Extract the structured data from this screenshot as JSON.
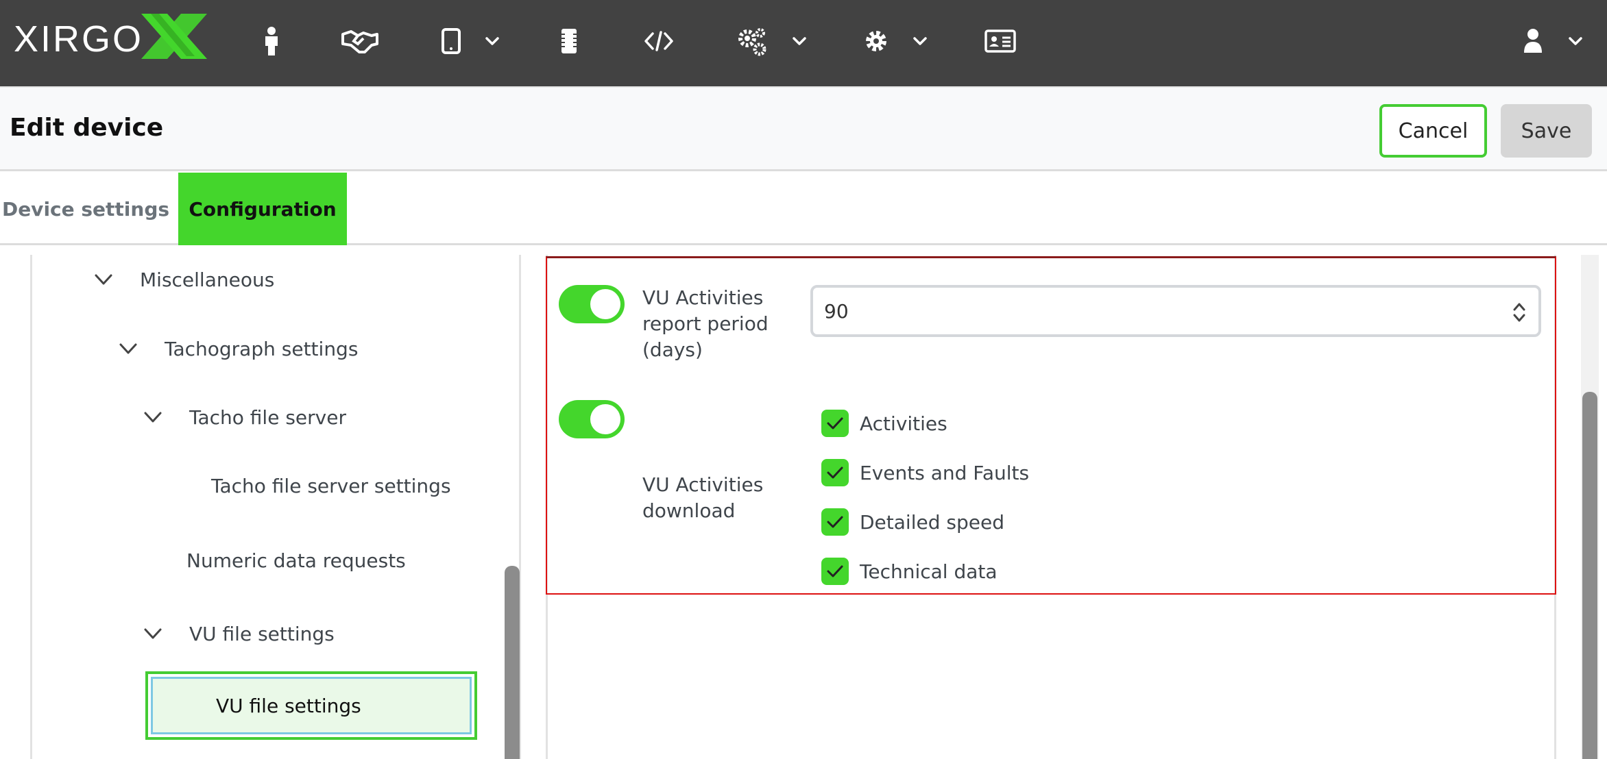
{
  "app": {
    "logo_text": "XIRGO",
    "brand_color": "#44d62c",
    "nav_icons": [
      "person-icon",
      "handshake-icon",
      "tablet-icon",
      "sim-card-icon",
      "code-icon",
      "cogs-icon",
      "gear-icon",
      "id-card-icon",
      "user-icon"
    ]
  },
  "header": {
    "title": "Edit device",
    "cancel_label": "Cancel",
    "save_label": "Save"
  },
  "tabs": [
    {
      "label": "Device settings",
      "active": false
    },
    {
      "label": "Configuration",
      "active": true
    }
  ],
  "tree": {
    "items": [
      {
        "label": "Miscellaneous",
        "expanded": true
      },
      {
        "label": "Tachograph settings",
        "expanded": true
      },
      {
        "label": "Tacho file server",
        "expanded": true
      },
      {
        "label": "Tacho file server settings"
      },
      {
        "label": "Numeric data requests"
      },
      {
        "label": "VU file settings",
        "expanded": true
      },
      {
        "label": "VU file settings",
        "selected": true
      }
    ]
  },
  "form": {
    "report_period": {
      "enabled": true,
      "label_lines": [
        "VU Activities",
        "report period",
        "(days)"
      ],
      "value": "90"
    },
    "download": {
      "enabled": true,
      "label_lines": [
        "VU Activities",
        "download"
      ],
      "options": [
        {
          "label": "Activities",
          "checked": true
        },
        {
          "label": "Events and Faults",
          "checked": true
        },
        {
          "label": "Detailed speed",
          "checked": true
        },
        {
          "label": "Technical data",
          "checked": true
        }
      ]
    }
  }
}
